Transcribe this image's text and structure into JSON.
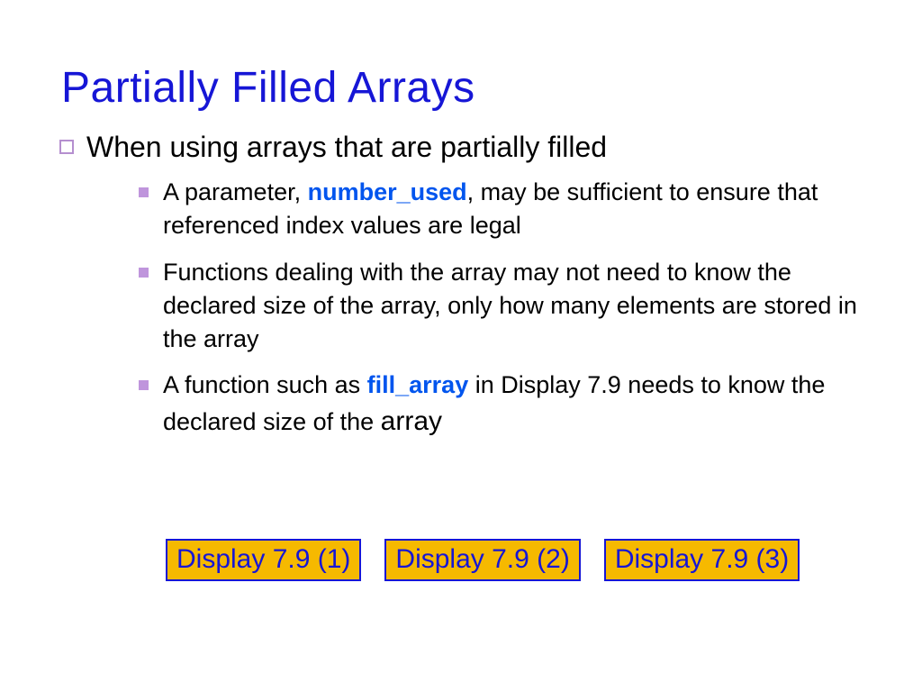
{
  "title": "Partially Filled Arrays",
  "top_bullet": "When using arrays that are partially filled",
  "subs": {
    "a_pre": "A parameter, ",
    "a_hl": "number_used",
    "a_post": ",  may be sufficient to ensure that referenced index values are legal",
    "b": "Functions dealing with the array may not need to know the declared size of the array, only how many elements are stored in the array",
    "c_pre": "A function such as ",
    "c_hl": "fill_array",
    "c_post": " in Display 7.9 needs to know the declared size of the ",
    "c_big": "array"
  },
  "buttons": {
    "b1": "Display 7.9 (1)",
    "b2": "Display 7.9 (2)",
    "b3": "Display 7.9 (3)"
  }
}
